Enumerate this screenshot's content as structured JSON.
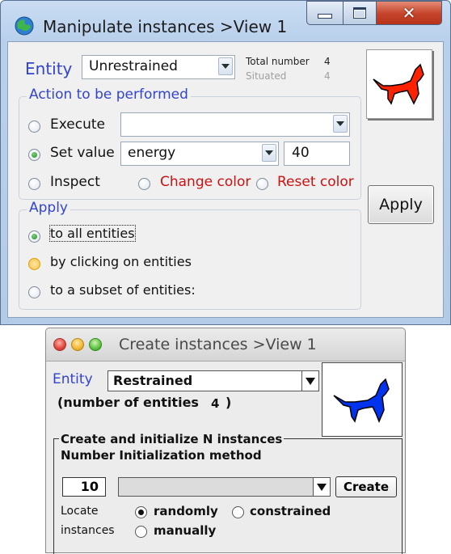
{
  "manipulate_window": {
    "title": "Manipulate instances >View 1",
    "entity_label": "Entity",
    "entity_value": "Unrestrained",
    "total_label": "Total number",
    "total_value": "4",
    "situated_label": "Situated",
    "situated_value": "4",
    "icon_color": "#ff2200",
    "action_group": {
      "title": "Action to be performed",
      "execute_label": "Execute",
      "execute_value": "",
      "setvalue_label": "Set value",
      "setvalue_field": "energy",
      "setvalue_number": "40",
      "inspect_label": "Inspect",
      "change_color_label": "Change color",
      "reset_color_label": "Reset color",
      "selected": "Set value"
    },
    "apply_group": {
      "title": "Apply",
      "options": [
        "to all entities",
        "by clicking on entities",
        "to a subset of entities:"
      ],
      "selected": "to all entities"
    },
    "apply_button": "Apply"
  },
  "create_window": {
    "title": "Create instances >View 1",
    "entity_label": "Entity",
    "entity_value": "Restrained",
    "number_of_entities_label": "(number of entities",
    "number_of_entities_value": "4",
    "number_of_entities_close": ")",
    "icon_color": "#0033ee",
    "group_title": "Create and initialize N instances",
    "number_init_label": "Number Initialization method",
    "n_value": "10",
    "method_value": "",
    "create_button": "Create",
    "locate_label_line1": "Locate",
    "locate_label_line2": "instances",
    "locate_options": {
      "randomly": "randomly",
      "constrained": "constrained",
      "manually": "manually"
    },
    "locate_selected": "randomly"
  }
}
